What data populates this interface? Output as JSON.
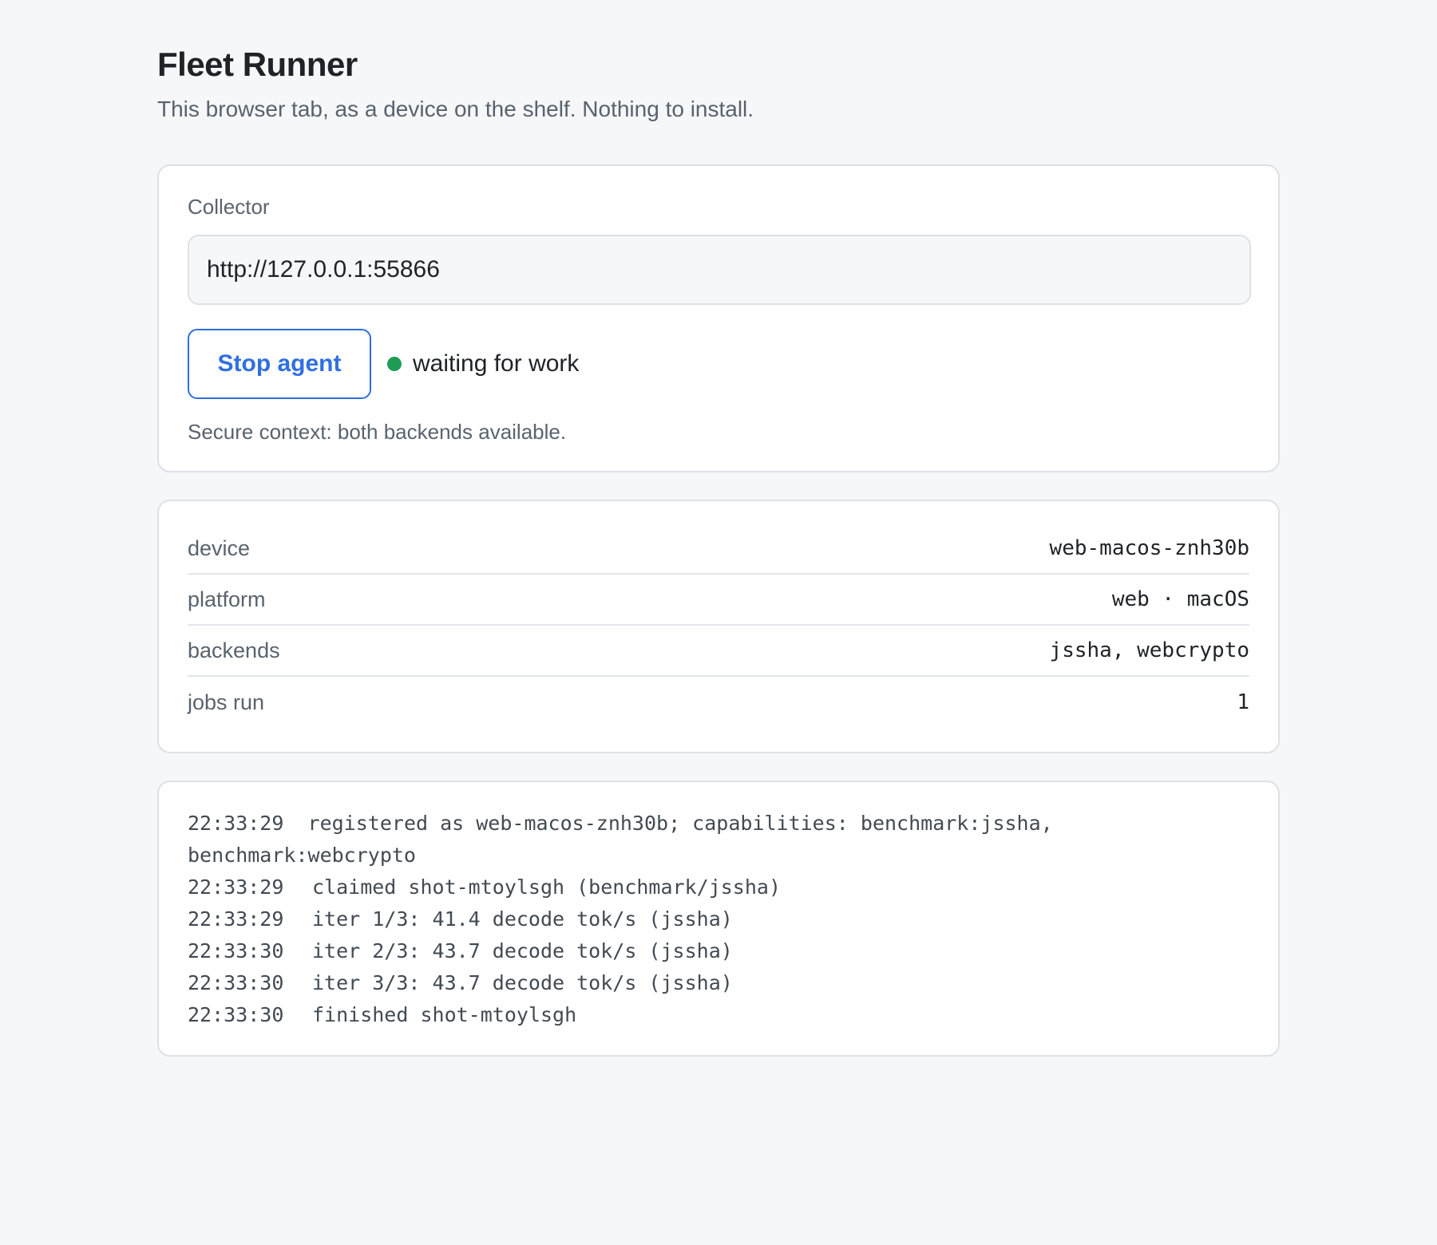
{
  "header": {
    "title": "Fleet Runner",
    "subtitle": "This browser tab, as a device on the shelf. Nothing to install."
  },
  "collector": {
    "label": "Collector",
    "url": "http://127.0.0.1:55866",
    "stop_label": "Stop agent",
    "status": "waiting for work",
    "status_color": "#1f9d55",
    "context_note": "Secure context: both backends available."
  },
  "info": {
    "rows": [
      {
        "key": "device",
        "value": "web-macos-znh30b"
      },
      {
        "key": "platform",
        "value": "web · macOS"
      },
      {
        "key": "backends",
        "value": "jssha, webcrypto"
      },
      {
        "key": "jobs run",
        "value": "1"
      }
    ]
  },
  "log": {
    "lines": [
      {
        "time": "22:33:29",
        "msg": "registered as web-macos-znh30b; capabilities: benchmark:jssha, benchmark:webcrypto"
      },
      {
        "time": "22:33:29",
        "msg": "claimed shot-mtoylsgh (benchmark/jssha)"
      },
      {
        "time": "22:33:29",
        "msg": "iter 1/3: 41.4 decode tok/s (jssha)"
      },
      {
        "time": "22:33:30",
        "msg": "iter 2/3: 43.7 decode tok/s (jssha)"
      },
      {
        "time": "22:33:30",
        "msg": "iter 3/3: 43.7 decode tok/s (jssha)"
      },
      {
        "time": "22:33:30",
        "msg": "finished shot-mtoylsgh"
      }
    ]
  },
  "accent_color": "#2f6fe0"
}
